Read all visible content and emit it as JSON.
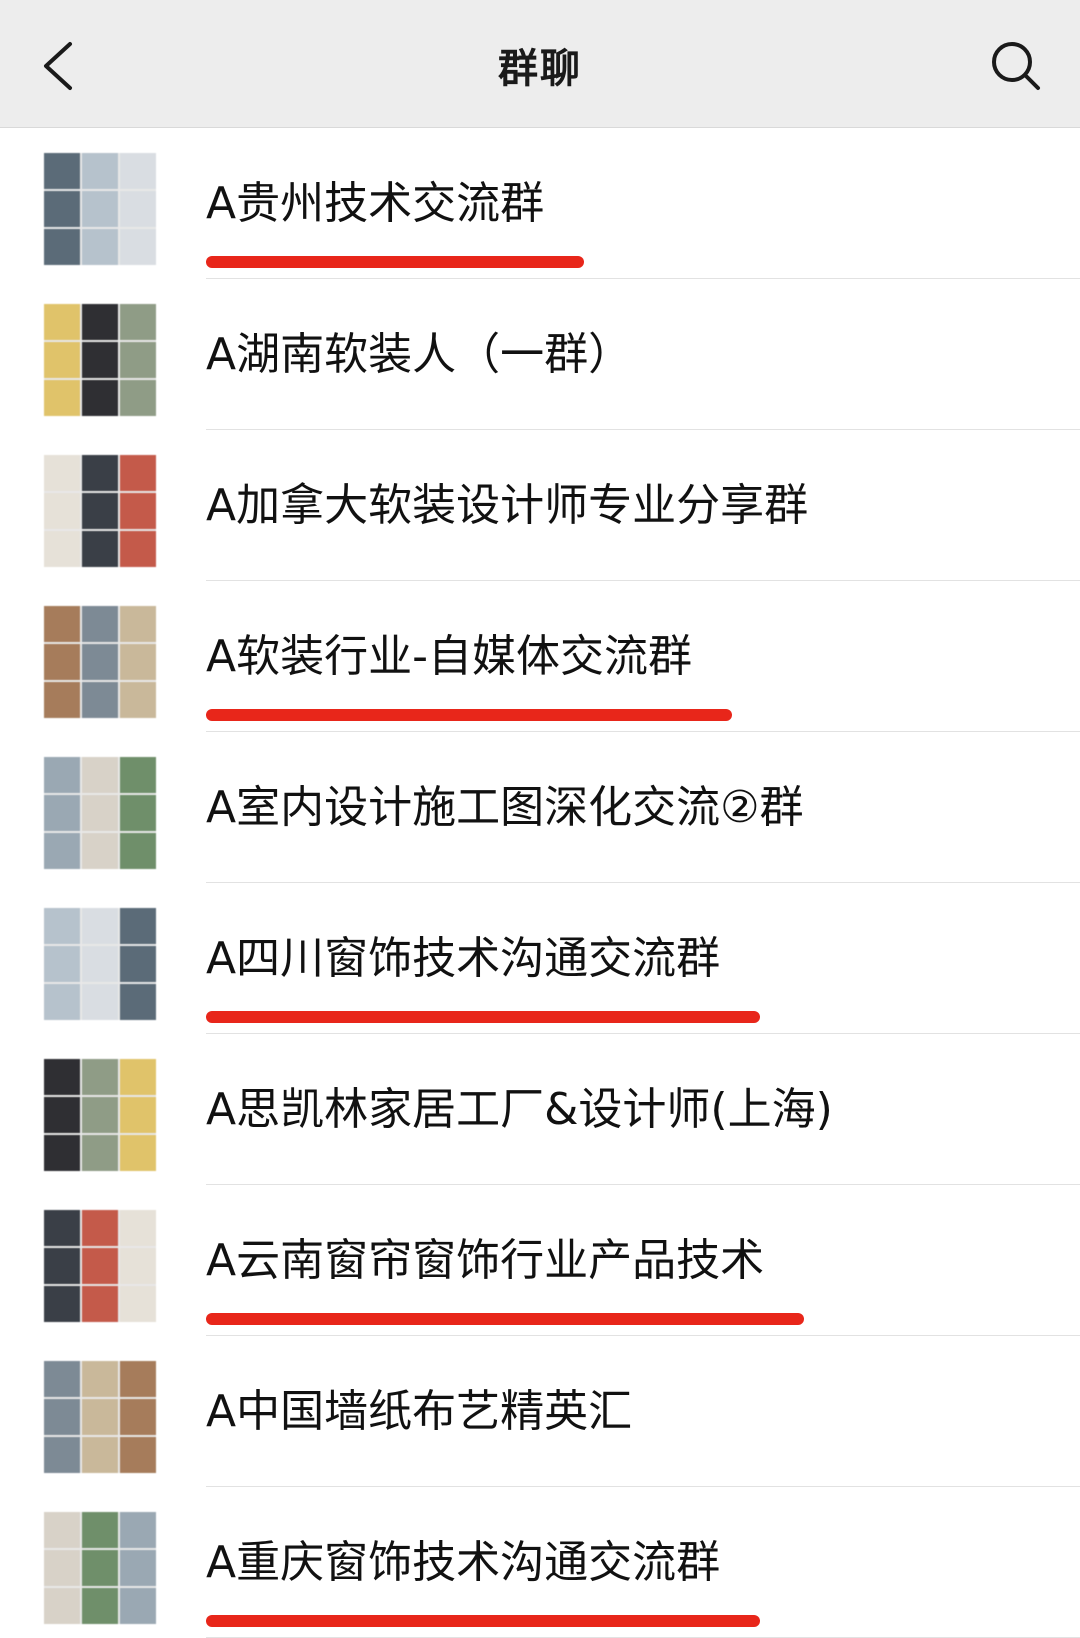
{
  "header": {
    "title": "群聊",
    "back_icon": "chevron-left-icon",
    "search_icon": "search-icon"
  },
  "groups": [
    {
      "name": "A贵州技术交流群",
      "highlighted": true
    },
    {
      "name": "A湖南软装人（一群）",
      "highlighted": false
    },
    {
      "name": "A加拿大软装设计师专业分享群",
      "highlighted": false
    },
    {
      "name": "A软装行业-自媒体交流群",
      "highlighted": true
    },
    {
      "name": "A室内设计施工图深化交流②群",
      "highlighted": false
    },
    {
      "name": "A四川窗饰技术沟通交流群",
      "highlighted": true
    },
    {
      "name": "A思凯林家居工厂&设计师(上海)",
      "highlighted": false
    },
    {
      "name": "A云南窗帘窗饰行业产品技术",
      "highlighted": true
    },
    {
      "name": "A中国墙纸布艺精英汇",
      "highlighted": false
    },
    {
      "name": "A重庆窗饰技术沟通交流群",
      "highlighted": true
    }
  ],
  "colors": {
    "header_bg": "#ededed",
    "text": "#111111",
    "divider": "#e2e2e2",
    "annotation": "#e8261a"
  }
}
